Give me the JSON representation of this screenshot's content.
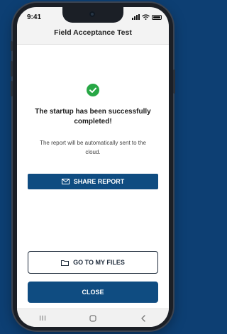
{
  "status_bar": {
    "time": "9:41",
    "icons": [
      "signal-icon",
      "wifi-icon",
      "battery-icon"
    ]
  },
  "header": {
    "title": "Field Acceptance Test"
  },
  "main": {
    "status_icon": "check-circle-icon",
    "headline": "The startup has been successfully completed!",
    "subtext": "The report will be automatically sent to the cloud."
  },
  "actions": {
    "share_label": "SHARE REPORT",
    "share_icon": "envelope-icon",
    "files_label": "GO TO MY FILES",
    "files_icon": "folder-icon",
    "close_label": "CLOSE"
  },
  "nav": {
    "items": [
      "recent-apps-icon",
      "home-icon",
      "back-icon"
    ]
  },
  "colors": {
    "background": "#0d3f73",
    "primary": "#0f4c81",
    "success": "#27a745",
    "outline": "#1e2b3b"
  }
}
